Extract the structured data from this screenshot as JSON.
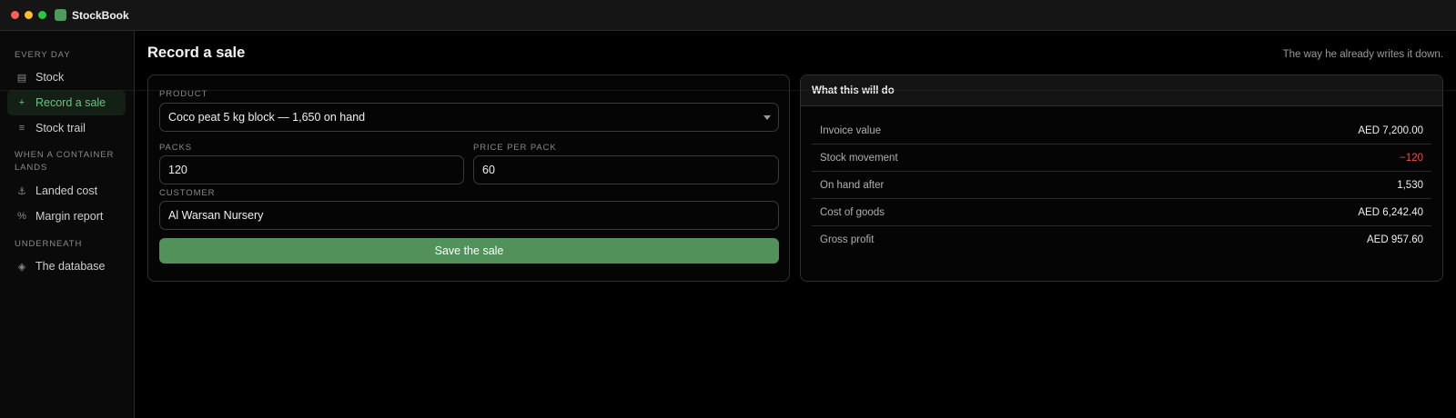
{
  "app": {
    "name": "StockBook",
    "icon": "app-icon",
    "accent": "#4e9a5d"
  },
  "sidebar": {
    "sections": [
      {
        "label": "EVERY DAY"
      },
      {
        "label": "WHEN A CONTAINER LANDS"
      },
      {
        "label": "UNDERNEATH"
      }
    ],
    "items": [
      {
        "label": "Stock",
        "icon": "table-icon",
        "glyph": "▤"
      },
      {
        "label": "Record a sale",
        "icon": "plus-icon",
        "glyph": "+",
        "active": true
      },
      {
        "label": "Stock trail",
        "icon": "list-icon",
        "glyph": "≡"
      },
      {
        "label": "Landed cost",
        "icon": "anchor-icon",
        "glyph": "⚓"
      },
      {
        "label": "Margin report",
        "icon": "percent-icon",
        "glyph": "%"
      },
      {
        "label": "The database",
        "icon": "diamond-icon",
        "glyph": "◈"
      }
    ]
  },
  "main": {
    "title": "Record a sale",
    "hint": "The way he already writes it down."
  },
  "form": {
    "product": {
      "label": "PRODUCT",
      "value": "Coco peat 5 kg block — 1,650 on hand"
    },
    "packs": {
      "label": "PACKS",
      "value": "120"
    },
    "price": {
      "label": "PRICE PER PACK",
      "value": "60"
    },
    "customer": {
      "label": "CUSTOMER",
      "value": "Al Warsan Nursery"
    },
    "save_label": "Save the sale",
    "save_color": "#52925a"
  },
  "summary": {
    "title": "What this will do",
    "rows": [
      {
        "label": "Invoice value",
        "value": "AED 7,200.00"
      },
      {
        "label": "Stock movement",
        "value": "−120",
        "negative_color": "#e5534b"
      },
      {
        "label": "On hand after",
        "value": "1,530"
      },
      {
        "label": "Cost of goods",
        "value": "AED 6,242.40"
      },
      {
        "label": "Gross profit",
        "value": "AED 957.60"
      }
    ]
  }
}
